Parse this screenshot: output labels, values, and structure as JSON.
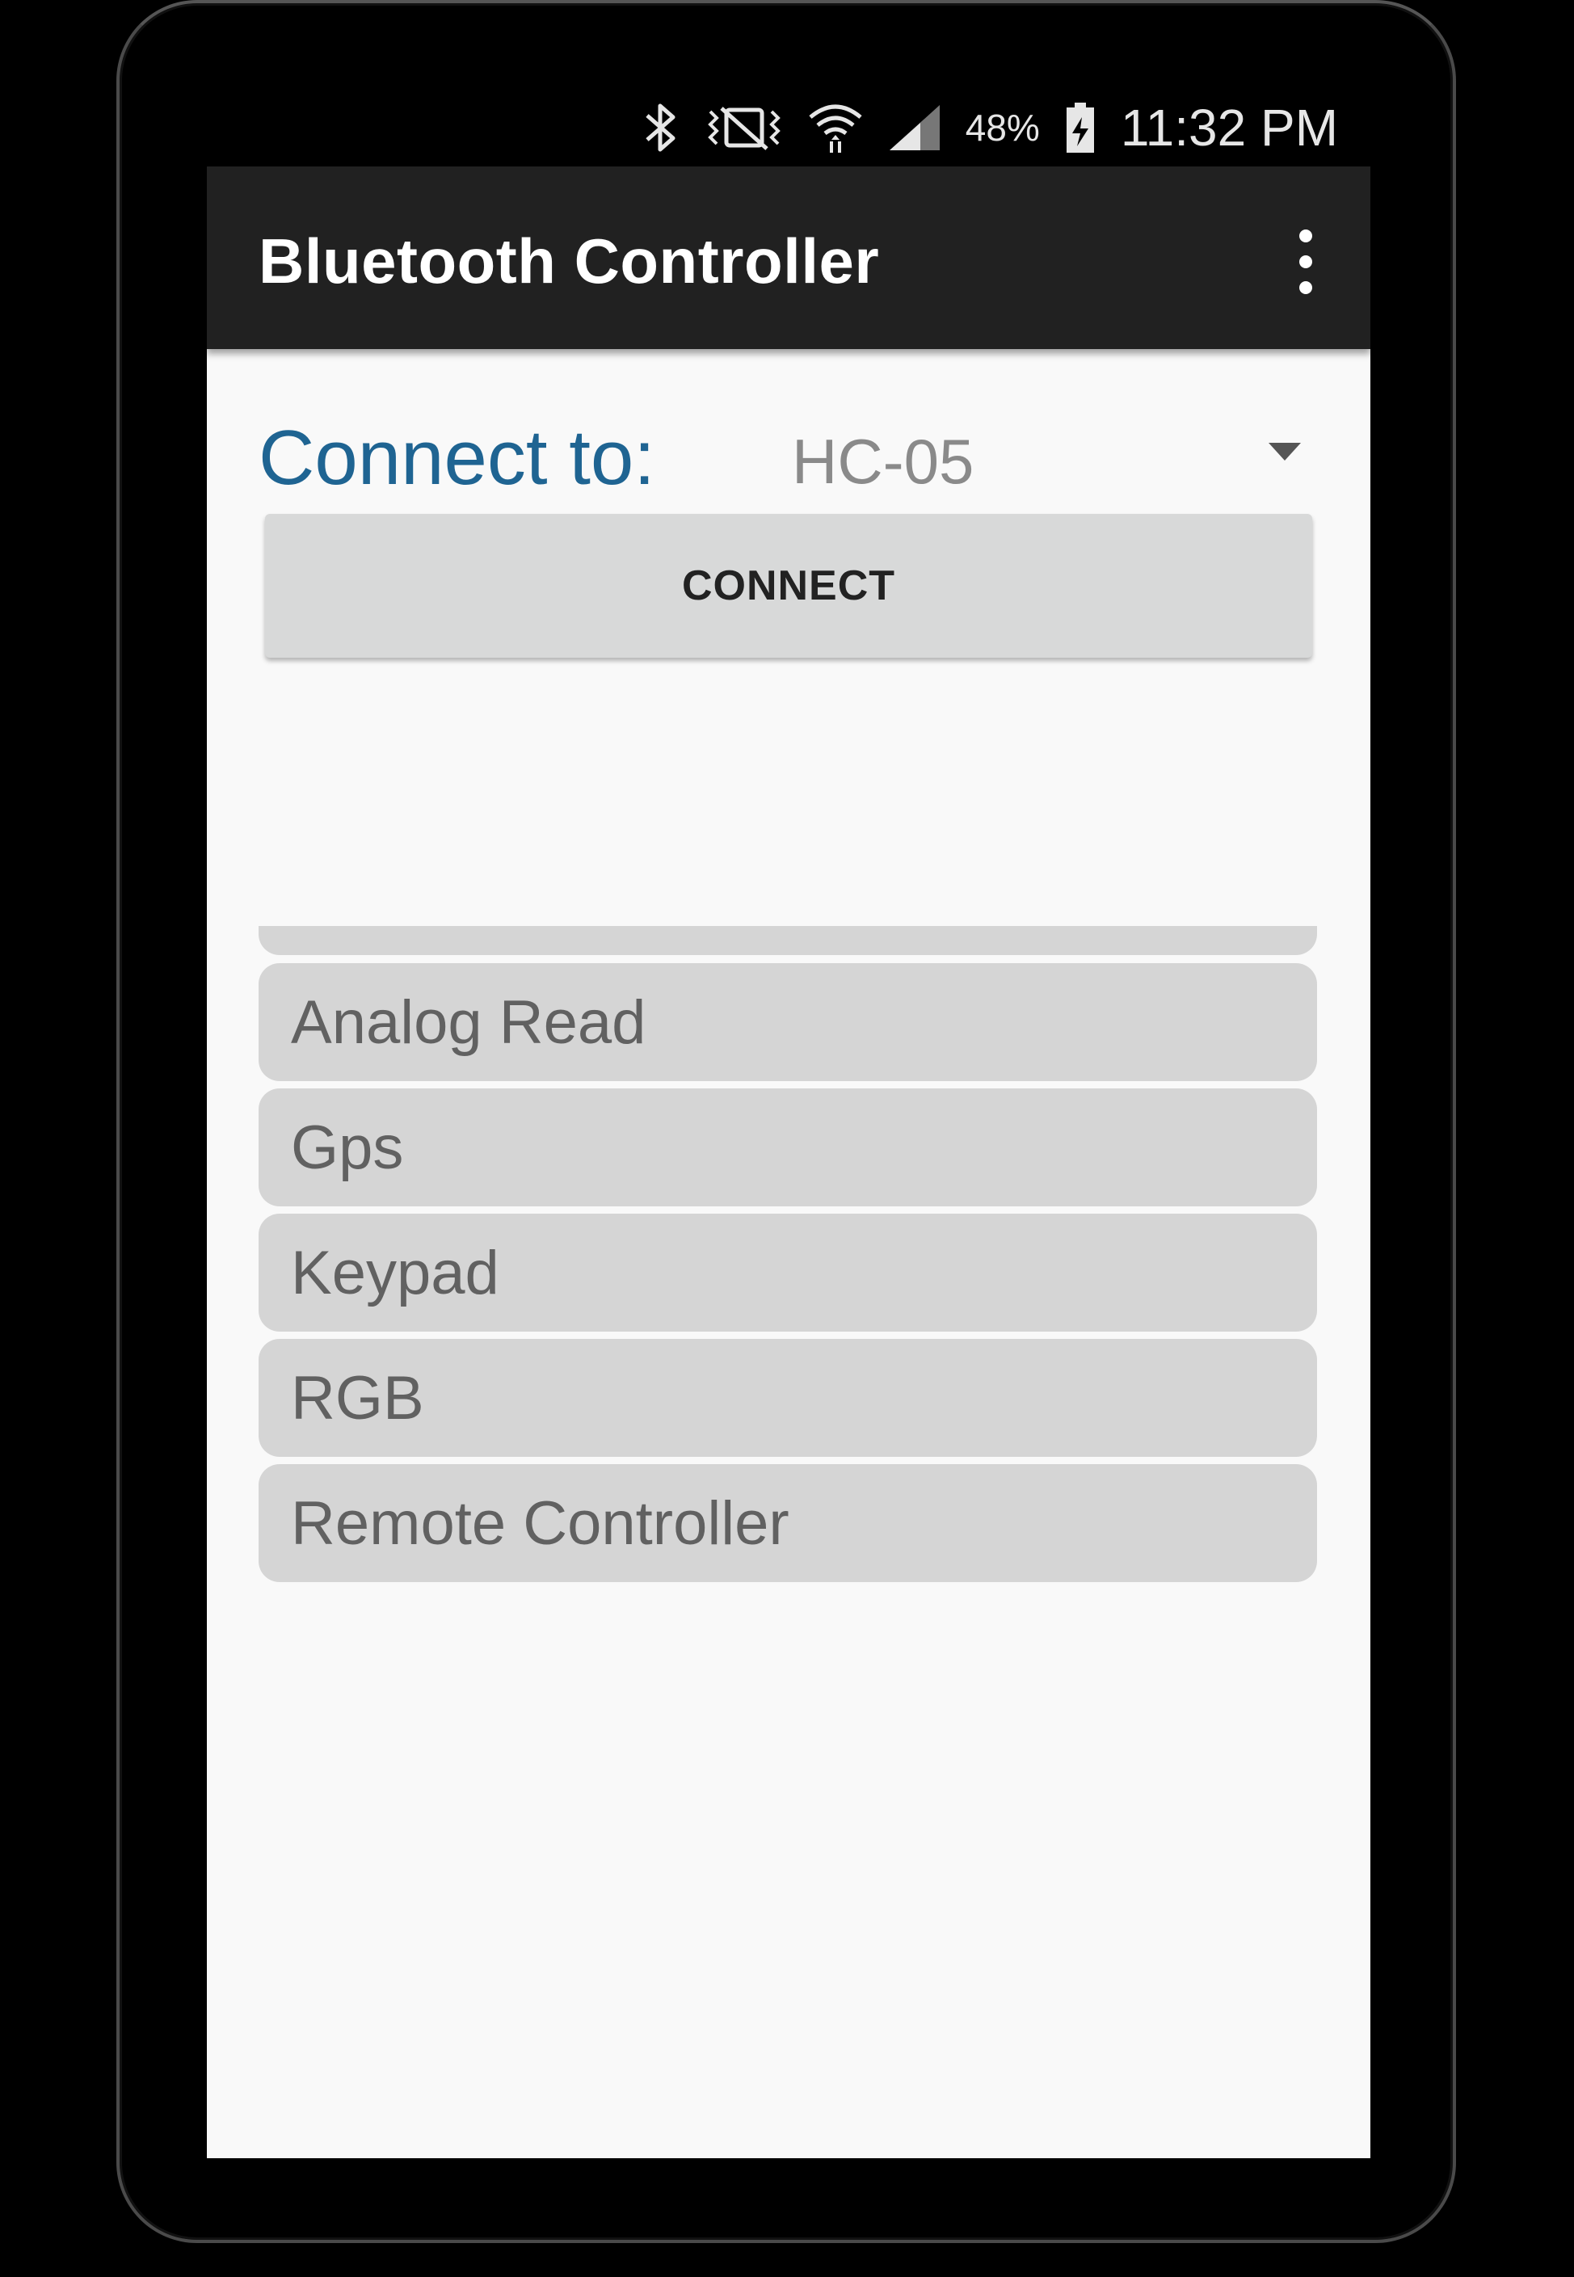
{
  "status_bar": {
    "icons": [
      "bluetooth-icon",
      "vibrate-icon",
      "wifi-icon",
      "signal-icon",
      "battery-charging-icon"
    ],
    "battery_percent": "48%",
    "time": "11:32 PM"
  },
  "appbar": {
    "title": "Bluetooth Controller",
    "overflow_icon": "more-vert-icon"
  },
  "connect": {
    "label": "Connect to:",
    "selected_device": "HC-05",
    "button_label": "CONNECT"
  },
  "modes": [
    "Analog Read",
    "Gps",
    "Keypad",
    "RGB",
    "Remote Controller"
  ],
  "colors": {
    "appbar": "#212121",
    "accent_label": "#1f6492",
    "button_bg": "#d8d9d9",
    "list_item_bg": "#d5d5d5"
  }
}
